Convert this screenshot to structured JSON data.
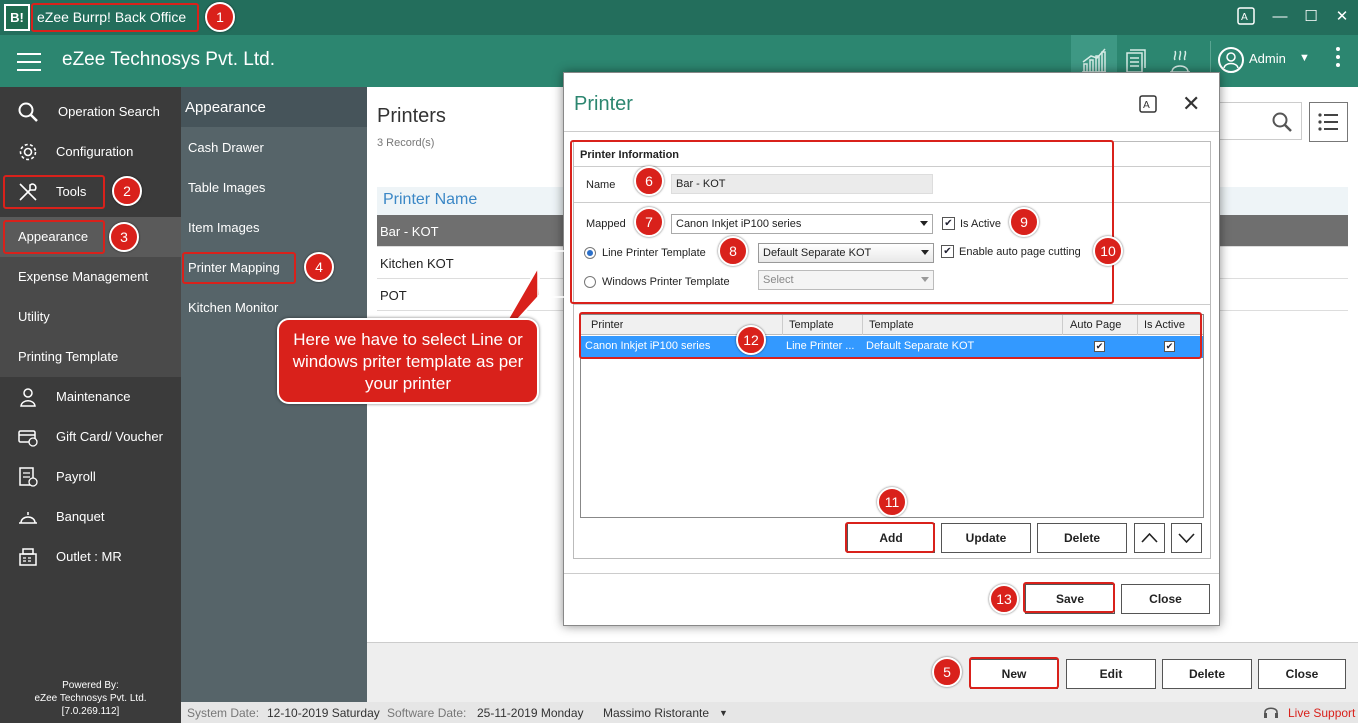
{
  "window": {
    "title": "eZee Burrp! Back Office",
    "logo_text": "B!"
  },
  "header": {
    "company": "eZee Technosys Pvt. Ltd.",
    "user": "Admin"
  },
  "sidebar": {
    "items": [
      {
        "label": "Operation Search",
        "icon": "search-icon"
      },
      {
        "label": "Configuration",
        "icon": "gear-icon"
      },
      {
        "label": "Tools",
        "icon": "tools-icon"
      },
      {
        "label": "Appearance"
      },
      {
        "label": "Expense Management"
      },
      {
        "label": "Utility"
      },
      {
        "label": "Printing Template"
      },
      {
        "label": "Maintenance",
        "icon": "maintenance-icon"
      },
      {
        "label": "Gift Card/ Voucher",
        "icon": "gift-card-icon"
      },
      {
        "label": "Payroll",
        "icon": "payroll-icon"
      },
      {
        "label": "Banquet",
        "icon": "banquet-icon"
      },
      {
        "label": "Outlet : MR",
        "icon": "outlet-icon"
      }
    ],
    "powered_by": "Powered By:",
    "powered_company": "eZee Technosys Pvt. Ltd.",
    "version": "[7.0.269.112]"
  },
  "subpanel": {
    "title": "Appearance",
    "items": [
      "Cash Drawer",
      "Table Images",
      "Item Images",
      "Printer Mapping",
      "Kitchen Monitor"
    ]
  },
  "main": {
    "title": "Printers",
    "records": "3 Record(s)",
    "column": "Printer Name",
    "rows": [
      "Bar - KOT",
      "Kitchen KOT",
      "POT"
    ],
    "buttons": {
      "new": "New",
      "edit": "Edit",
      "delete": "Delete",
      "close": "Close"
    }
  },
  "statusbar": {
    "system_date_label": "System Date:",
    "system_date": "12-10-2019 Saturday",
    "software_date_label": "Software Date:",
    "software_date": "25-11-2019 Monday",
    "outlet": "Massimo Ristorante",
    "live_support": "Live Support"
  },
  "dialog": {
    "title": "Printer",
    "section": "Printer Information",
    "name_label": "Name",
    "name_value": "Bar - KOT",
    "mapped_label": "Mapped",
    "mapped_value": "Canon Inkjet iP100 series",
    "is_active_label": "Is Active",
    "is_active": true,
    "line_template_label": "Line Printer Template",
    "line_template_value": "Default Separate KOT",
    "auto_cut_label": "Enable auto page cutting",
    "auto_cut": true,
    "windows_template_label": "Windows Printer Template",
    "windows_template_value": "Select",
    "grid": {
      "headers": [
        "Printer",
        "Template",
        "Template",
        "Auto Page",
        "Is Active"
      ],
      "row": [
        "Canon Inkjet iP100 series",
        "Line Printer ...",
        "Default Separate KOT"
      ]
    },
    "buttons": {
      "add": "Add",
      "update": "Update",
      "delete": "Delete",
      "save": "Save",
      "close": "Close"
    }
  },
  "callout": "Here we have to select Line or windows priter template as per your printer",
  "annotations": [
    "1",
    "2",
    "3",
    "4",
    "5",
    "6",
    "7",
    "8",
    "9",
    "10",
    "11",
    "12",
    "13"
  ],
  "colors": {
    "annotation": "#d9211b",
    "header": "#2c8670",
    "titlebar": "#236e5c",
    "selection": "#3399ff"
  }
}
